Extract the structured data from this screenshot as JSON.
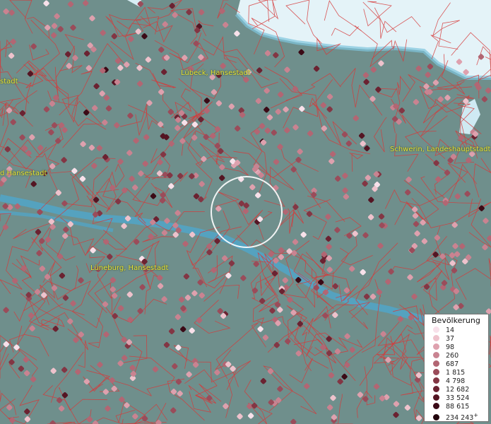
{
  "map": {
    "colors": {
      "land": "#6f8f8c",
      "water": "#5aa8c8",
      "sea": "#e4f3f8",
      "boundaries": "#d63a3a",
      "labels": "#e6e63a"
    },
    "city_labels": [
      {
        "id": "luebeck",
        "text": "Lübeck, Hansestadt"
      },
      {
        "id": "schwerin",
        "text": "Schwerin, Landeshauptstadt"
      },
      {
        "id": "hamburg",
        "text": "d Hansestadt"
      },
      {
        "id": "lueneburg",
        "text": "Lüneburg, Hansestadt"
      },
      {
        "id": "kiel",
        "text": "stadt"
      }
    ]
  },
  "legend": {
    "title": "Bevölkerung",
    "items": [
      {
        "label": "14",
        "color": "#f8e1ea"
      },
      {
        "label": "37",
        "color": "#eec2cc"
      },
      {
        "label": "98",
        "color": "#dea1ae"
      },
      {
        "label": "260",
        "color": "#c98391"
      },
      {
        "label": "687",
        "color": "#b26673"
      },
      {
        "label": "1 815",
        "color": "#9a4c5a"
      },
      {
        "label": "4 798",
        "color": "#833644"
      },
      {
        "label": "12 682",
        "color": "#6b2231"
      },
      {
        "label": "33 524",
        "color": "#541523"
      },
      {
        "label": "88 615",
        "color": "#3b0a16"
      },
      {
        "label": "234 243",
        "color": "#22040c"
      }
    ],
    "overflow_marker": "+"
  }
}
